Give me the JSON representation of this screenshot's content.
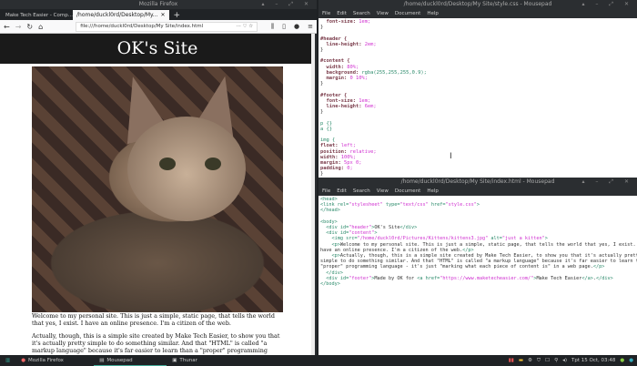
{
  "firefox": {
    "window_title": "Mozilla Firefox",
    "tabs": [
      {
        "label": "Make Tech Easier - Comp..."
      },
      {
        "label": "/home/duckl0rd/Desktop/My..."
      }
    ],
    "url": "file:///home/duckl0rd/Desktop/My Site/index.html",
    "page": {
      "header": "OK's Site",
      "image_alt": "just a kitten",
      "paragraphs": [
        "Welcome to my personal site. This is just a simple, static page, that tells the world that yes, I exist. I have an online presence. I'm a citizen of the web.",
        "Actually, though, this is a simple site created by Make Tech Easier, to show you that it's actually pretty simple to do something similar. And that \"HTML\" is called \"a markup language\" because it's far easier to learn than a \"proper\" programming language - it's just \"marking what each piece of content is\" in a web page."
      ]
    }
  },
  "editor_css": {
    "title": "/home/duckl0rd/Desktop/My Site/style.css - Mousepad",
    "menu": [
      "File",
      "Edit",
      "Search",
      "View",
      "Document",
      "Help"
    ],
    "lines": [
      [
        [
          "  font-size: ",
          "k"
        ],
        [
          "1em;",
          "v"
        ]
      ],
      [
        [
          "}",
          ""
        ]
      ],
      [
        [
          "",
          ""
        ]
      ],
      [
        [
          "#header {",
          "k"
        ]
      ],
      [
        [
          "  line-height: ",
          "k"
        ],
        [
          "2em;",
          "v"
        ]
      ],
      [
        [
          "}",
          ""
        ]
      ],
      [
        [
          "",
          ""
        ]
      ],
      [
        [
          "#content {",
          "k"
        ]
      ],
      [
        [
          "  width: ",
          "k"
        ],
        [
          "80%;",
          "v"
        ]
      ],
      [
        [
          "  background: ",
          "k"
        ],
        [
          "rgba(255,255,255,0.9);",
          "t"
        ]
      ],
      [
        [
          "  margin: ",
          "k"
        ],
        [
          "0 10%;",
          "v"
        ]
      ],
      [
        [
          "}",
          ""
        ]
      ],
      [
        [
          "",
          ""
        ]
      ],
      [
        [
          "#footer {",
          "k"
        ]
      ],
      [
        [
          "  font-size: ",
          "k"
        ],
        [
          "1em;",
          "v"
        ]
      ],
      [
        [
          "  line-height: ",
          "k"
        ],
        [
          "6em;",
          "v"
        ]
      ],
      [
        [
          "}",
          ""
        ]
      ],
      [
        [
          "",
          ""
        ]
      ],
      [
        [
          "p {}",
          "t"
        ]
      ],
      [
        [
          "a {}",
          "t"
        ]
      ],
      [
        [
          "",
          ""
        ]
      ],
      [
        [
          "img {",
          "t"
        ]
      ],
      [
        [
          "float: ",
          "k"
        ],
        [
          "left;",
          "v"
        ]
      ],
      [
        [
          "position: ",
          "k"
        ],
        [
          "relative;",
          "v"
        ]
      ],
      [
        [
          "width: ",
          "k"
        ],
        [
          "100%;",
          "v"
        ]
      ],
      [
        [
          "margin: ",
          "k"
        ],
        [
          "5px 0;",
          "v"
        ]
      ],
      [
        [
          "padding: ",
          "k"
        ],
        [
          "0;",
          "v"
        ]
      ],
      [
        [
          "}",
          ""
        ]
      ]
    ]
  },
  "editor_html": {
    "title": "/home/duckl0rd/Desktop/My Site/index.html - Mousepad",
    "menu": [
      "File",
      "Edit",
      "Search",
      "View",
      "Document",
      "Help"
    ],
    "lines": [
      [
        [
          "<head>",
          "t"
        ]
      ],
      [
        [
          "<link ",
          "t"
        ],
        [
          "rel=",
          "t"
        ],
        [
          "\"stylesheet\" ",
          "s"
        ],
        [
          "type=",
          "t"
        ],
        [
          "\"text/css\" ",
          "s"
        ],
        [
          "href=",
          "t"
        ],
        [
          "\"style.css\"",
          "s"
        ],
        [
          ">",
          "t"
        ]
      ],
      [
        [
          "</head>",
          "t"
        ]
      ],
      [
        [
          "",
          ""
        ]
      ],
      [
        [
          "<body>",
          "t"
        ]
      ],
      [
        [
          "  <div ",
          "t"
        ],
        [
          "id=",
          "t"
        ],
        [
          "\"header\"",
          "s"
        ],
        [
          ">",
          "t"
        ],
        [
          "OK's Site",
          ""
        ],
        [
          "</div>",
          "t"
        ]
      ],
      [
        [
          "  <div ",
          "t"
        ],
        [
          "id=",
          "t"
        ],
        [
          "\"content\"",
          "s"
        ],
        [
          ">",
          "t"
        ]
      ],
      [
        [
          "    <img ",
          "t"
        ],
        [
          "src=",
          "t"
        ],
        [
          "\"/home/duckl0rd/Pictures/Kittens/kittens3.jpg\" ",
          "s"
        ],
        [
          "alt=",
          "t"
        ],
        [
          "\"just a kitten\"",
          "s"
        ],
        [
          ">",
          "t"
        ]
      ],
      [
        [
          "    <p>",
          "t"
        ],
        [
          "Welcome to my personal site. This is just a simple, static page, that tells the world that yes, I exist. I",
          ""
        ]
      ],
      [
        [
          "have an online presence. I'm a citizen of the web.",
          ""
        ],
        [
          "</p>",
          "t"
        ]
      ],
      [
        [
          "    <p>",
          "t"
        ],
        [
          "Actually, though, this is a simple site created by Make Tech Easier, to show you that it's actually pretty",
          ""
        ]
      ],
      [
        [
          "simple to do something similar. And that \"HTML\" is called \"a markup language\" because it's far easier to learn than a",
          ""
        ]
      ],
      [
        [
          "\"proper\" programming language - it's just \"marking what each piece of content is\" in a web page.",
          ""
        ],
        [
          "</p>",
          "t"
        ]
      ],
      [
        [
          "  </div>",
          "t"
        ]
      ],
      [
        [
          "  <div ",
          "t"
        ],
        [
          "id=",
          "t"
        ],
        [
          "\"footer\"",
          "s"
        ],
        [
          ">",
          "t"
        ],
        [
          "Made by OK for ",
          ""
        ],
        [
          "<a ",
          "t"
        ],
        [
          "href=",
          "t"
        ],
        [
          "\"https://www.maketecheasier.com/\"",
          "s"
        ],
        [
          ">",
          "t"
        ],
        [
          "Make Tech Easier",
          ""
        ],
        [
          "</a>",
          "t"
        ],
        [
          ".",
          ""
        ],
        [
          "</div>",
          "t"
        ]
      ],
      [
        [
          "</body>",
          "t"
        ]
      ]
    ]
  },
  "taskbar": {
    "tasks": [
      "Mozilla Firefox",
      "Mousepad",
      "Thunar"
    ],
    "clock": "Tpt 15 Oct, 03:48"
  }
}
